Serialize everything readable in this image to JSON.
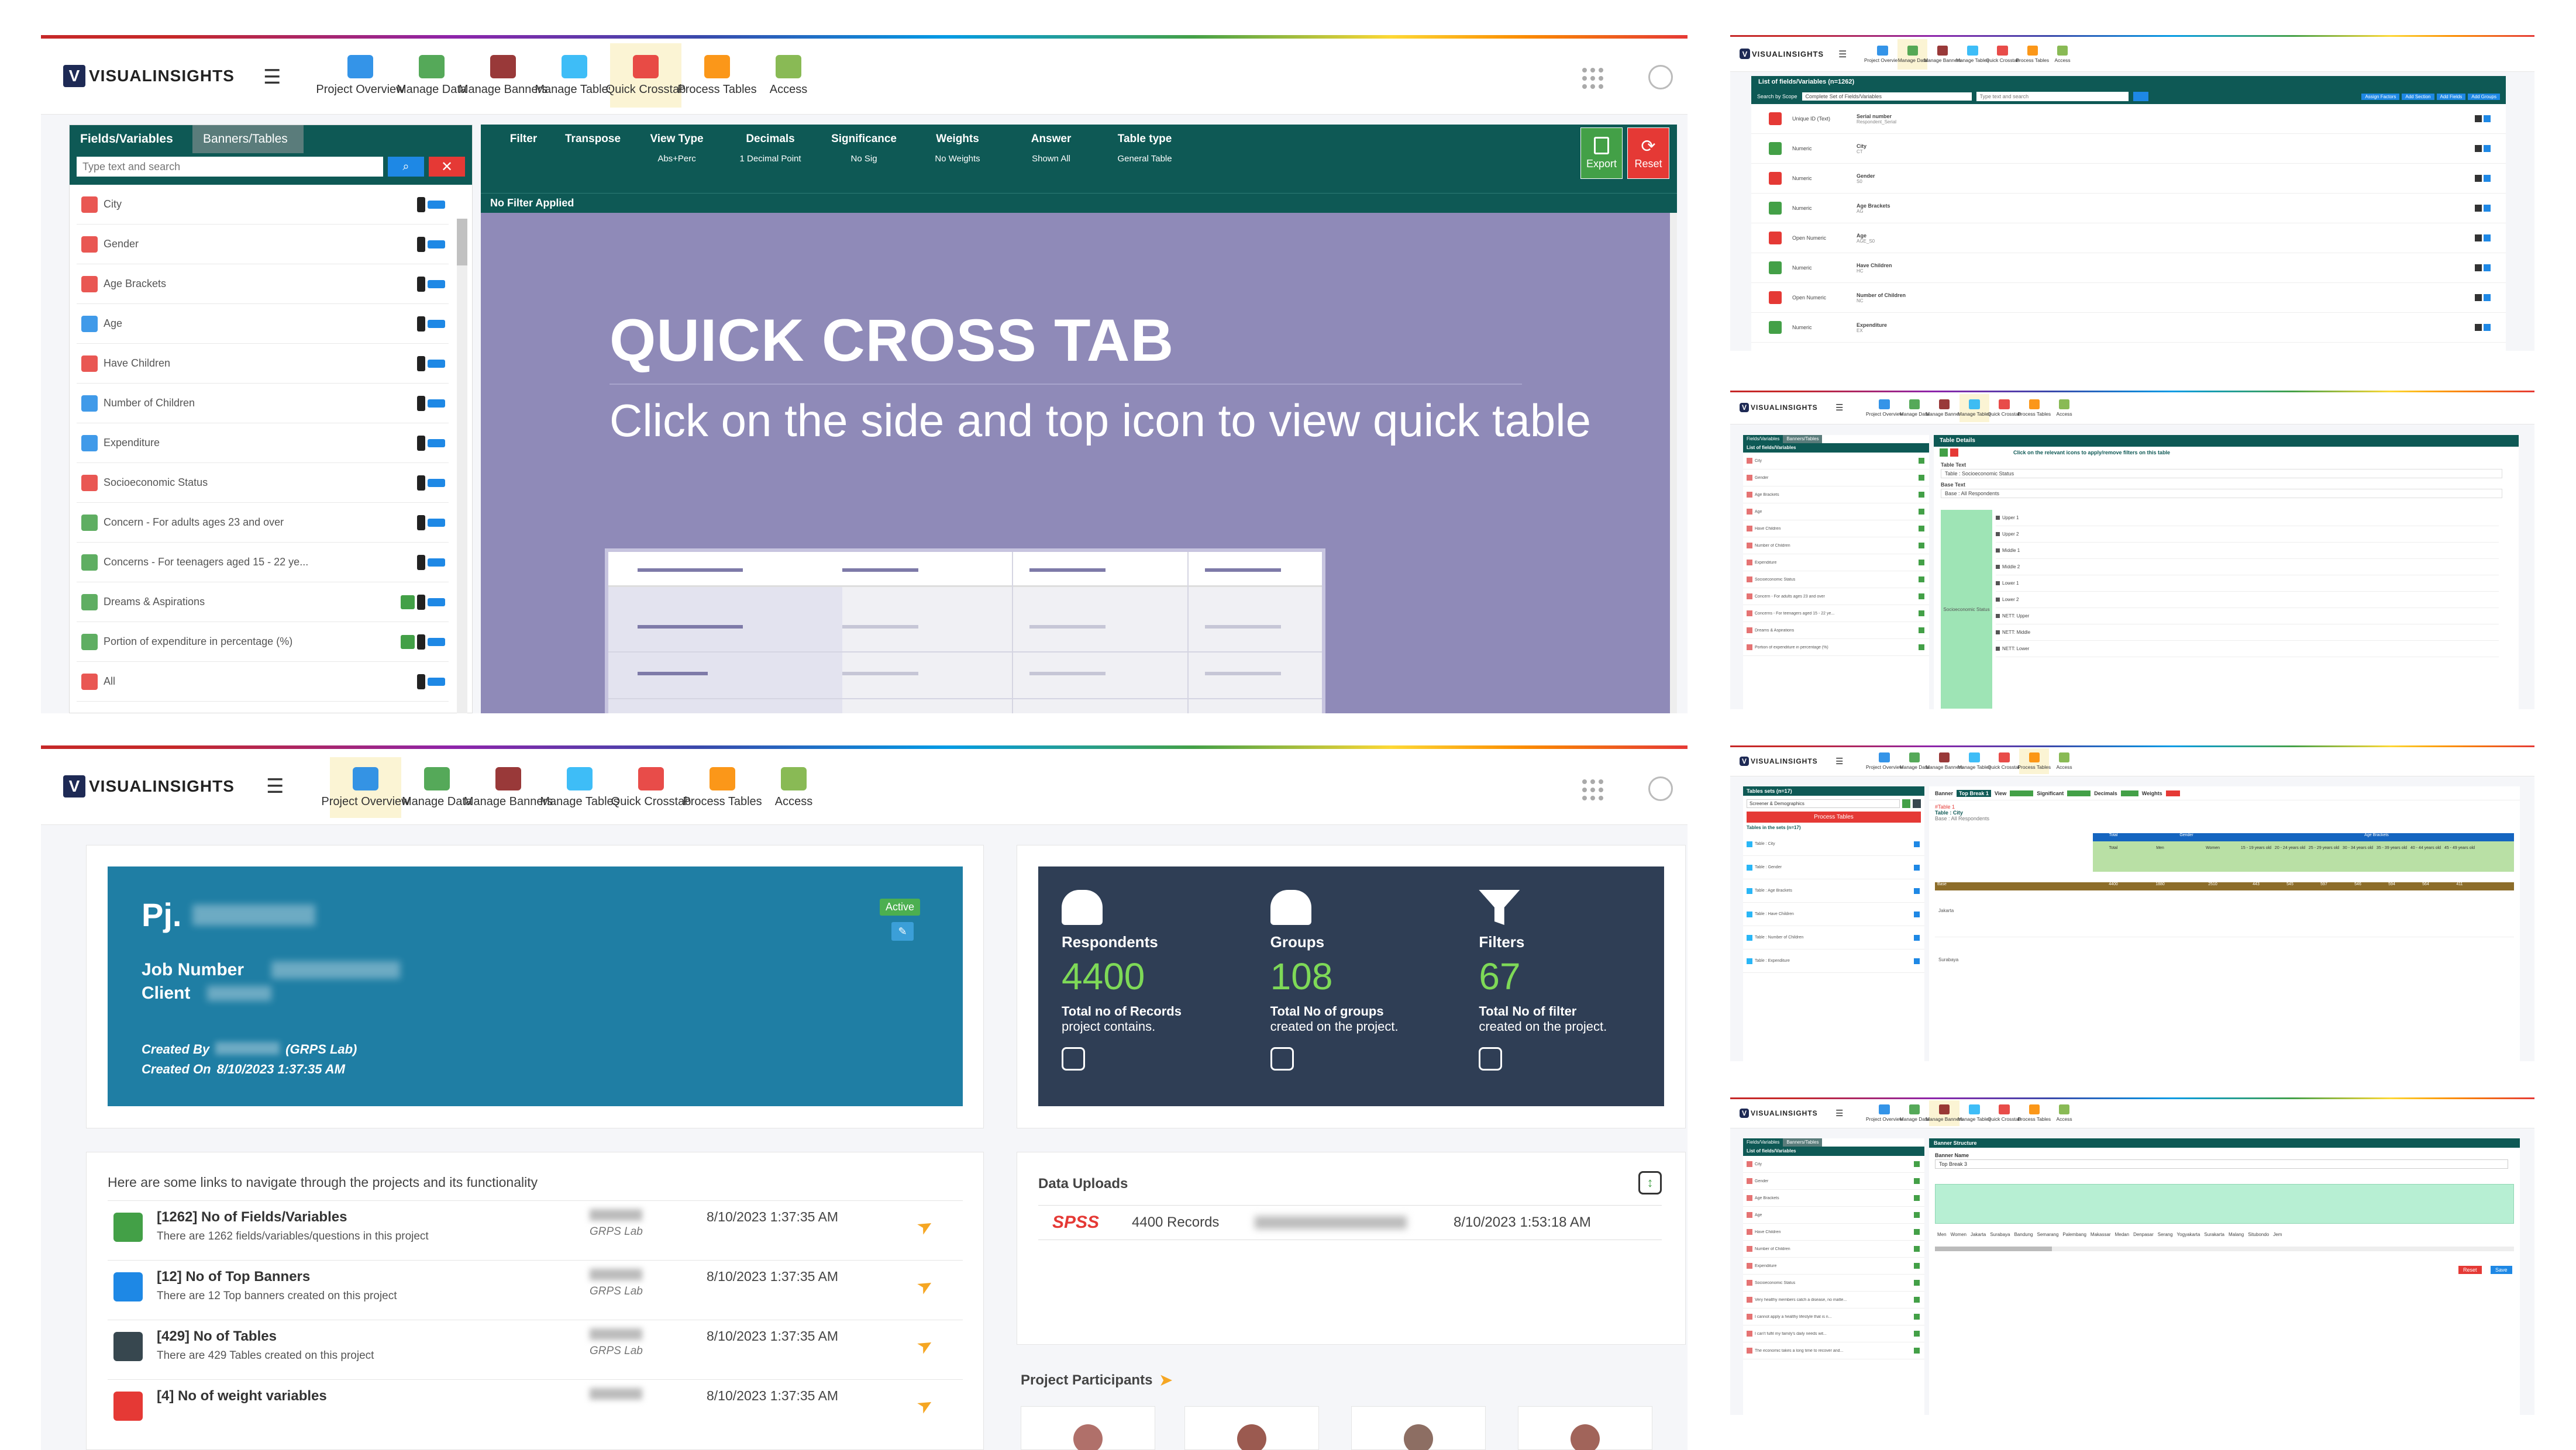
{
  "nav": {
    "logo_text": "VISUALINSIGHTS",
    "logo_letter": "V",
    "items": [
      {
        "label": "Project Overview",
        "icon": "chart-search-icon",
        "color": "#1e88e5"
      },
      {
        "label": "Manage Data",
        "icon": "data-icon",
        "color": "#43a047"
      },
      {
        "label": "Manage Banners",
        "icon": "banner-icon",
        "color": "#8e2424"
      },
      {
        "label": "Manage Tables",
        "icon": "table-icon",
        "color": "#29b6f6"
      },
      {
        "label": "Quick Crosstab",
        "icon": "crosstab-icon",
        "color": "#e53935"
      },
      {
        "label": "Process Tables",
        "icon": "magic-wand-icon",
        "color": "#fb8c00"
      },
      {
        "label": "Access",
        "icon": "users-icon",
        "color": "#7cb342"
      }
    ]
  },
  "crosstab": {
    "tabs": [
      "Fields/Variables",
      "Banners/Tables"
    ],
    "search_placeholder": "Type text and search",
    "variables": [
      {
        "name": "City",
        "type": "single"
      },
      {
        "name": "Gender",
        "type": "single"
      },
      {
        "name": "Age Brackets",
        "type": "single"
      },
      {
        "name": "Age",
        "type": "numeric"
      },
      {
        "name": "Have Children",
        "type": "single"
      },
      {
        "name": "Number of Children",
        "type": "numeric"
      },
      {
        "name": "Expenditure",
        "type": "numeric"
      },
      {
        "name": "Socioeconomic Status",
        "type": "single"
      },
      {
        "name": "Concern - For adults ages 23 and over",
        "type": "multi"
      },
      {
        "name": "Concerns - For teenagers aged 15 - 22 ye...",
        "type": "multi"
      },
      {
        "name": "Dreams & Aspirations",
        "type": "multi"
      },
      {
        "name": "Portion of expenditure in percentage (%)",
        "type": "multi"
      },
      {
        "name": "All",
        "type": "single"
      }
    ],
    "toolbar": [
      {
        "label": "Filter",
        "sub": ""
      },
      {
        "label": "Transpose",
        "sub": ""
      },
      {
        "label": "View Type",
        "sub": "Abs+Perc"
      },
      {
        "label": "Decimals",
        "sub": "1 Decimal Point"
      },
      {
        "label": "Significance",
        "sub": "No Sig"
      },
      {
        "label": "Weights",
        "sub": "No Weights"
      },
      {
        "label": "Answer",
        "sub": "Shown All"
      },
      {
        "label": "Table type",
        "sub": "General Table"
      }
    ],
    "export_label": "Export",
    "reset_label": "Reset",
    "filter_status": "No Filter Applied",
    "hero_title": "QUICK CROSS TAB",
    "hero_sub": "Click on the side and top icon to view quick table"
  },
  "overview": {
    "project_initial": "Pj.",
    "status": "Active",
    "job_number_label": "Job Number",
    "client_label": "Client",
    "created_by_label": "Created By",
    "created_by_org": "(GRPS Lab)",
    "created_on_label": "Created On",
    "created_on_value": "8/10/2023 1:37:35 AM",
    "stats": [
      {
        "title": "Respondents",
        "value": "4400",
        "desc1": "Total no of Records",
        "desc2": "project contains.",
        "icon": "people-icon"
      },
      {
        "title": "Groups",
        "value": "108",
        "desc1": "Total No of groups",
        "desc2": "created on the project.",
        "icon": "group-icon"
      },
      {
        "title": "Filters",
        "value": "67",
        "desc1": "Total No of filter",
        "desc2": "created on the project.",
        "icon": "funnel-icon"
      }
    ],
    "links_header": "Here are some links to navigate through the projects and its functionality",
    "links": [
      {
        "title": "[1262] No of Fields/Variables",
        "desc": "There are 1262 fields/variables/questions in this project",
        "org": "GRPS Lab",
        "date": "8/10/2023 1:37:35 AM",
        "icon": "map-icon",
        "color": "#43a047"
      },
      {
        "title": "[12] No of Top Banners",
        "desc": "There are 12 Top banners created on this project",
        "org": "GRPS Lab",
        "date": "8/10/2023 1:37:35 AM",
        "icon": "css-icon",
        "color": "#1e88e5"
      },
      {
        "title": "[429] No of Tables",
        "desc": "There are 429 Tables created on this project",
        "org": "GRPS Lab",
        "date": "8/10/2023 1:37:35 AM",
        "icon": "table-list-icon",
        "color": "#37474f"
      },
      {
        "title": "[4] No of weight variables",
        "desc": "",
        "org": "",
        "date": "8/10/2023 1:37:35 AM",
        "icon": "weight-icon",
        "color": "#e53935"
      }
    ],
    "uploads_header": "Data Uploads",
    "upload": {
      "type": "SPSS",
      "records": "4400 Records",
      "date": "8/10/2023 1:53:18 AM"
    },
    "participants_header": "Project Participants"
  },
  "thumbs": {
    "data": {
      "header": "List of fields/Variables (n=1262)",
      "search_label": "Search by Scope",
      "search_scope": "Complete Set of Fields/Variables",
      "search_placeholder": "Type text and search",
      "buttons": [
        "Assign Factors",
        "Add Section",
        "Add Fields",
        "Add Groups"
      ],
      "rows": [
        {
          "type": "Unique ID (Text)",
          "name": "Serial number",
          "code": "Respondent_Serial"
        },
        {
          "type": "Numeric",
          "name": "City",
          "code": "CT"
        },
        {
          "type": "Numeric",
          "name": "Gender",
          "code": "S0"
        },
        {
          "type": "Numeric",
          "name": "Age Brackets",
          "code": "AG"
        },
        {
          "type": "Open Numeric",
          "name": "Age",
          "code": "AGE_S0"
        },
        {
          "type": "Numeric",
          "name": "Have Children",
          "code": "HC"
        },
        {
          "type": "Open Numeric",
          "name": "Number of Children",
          "code": "NC"
        },
        {
          "type": "Numeric",
          "name": "Expenditure",
          "code": "EX"
        }
      ]
    },
    "tables": {
      "header": "Table Details",
      "hint": "Click on the relevant icons to apply/remove filters on this table",
      "table_text_label": "Table Text",
      "table_text": "Table : Socioeconomic Status",
      "base_text_label": "Base Text",
      "base_text": "Base : All Respondents",
      "side_label": "Socioeconomic Status",
      "codes": [
        "Upper 1",
        "Upper 2",
        "Middle 1",
        "Middle 2",
        "Lower 1",
        "Lower 2",
        "NETT: Upper",
        "NETT: Middle",
        "NETT: Lower"
      ],
      "list_header": "List of fields/Variables",
      "list": [
        "City",
        "Gender",
        "Age Brackets",
        "Age",
        "Have Children",
        "Number of Children",
        "Expenditure",
        "Socioeconomic Status",
        "Concern - For adults ages 23 and over",
        "Concerns - For teenagers aged 15 - 22 ye...",
        "Dreams & Aspirations",
        "Portion of expenditure in percentage (%)"
      ]
    },
    "process": {
      "sets_header": "Tables sets (n=17)",
      "set_select": "Screener & Demographics",
      "process_btn": "Process Tables",
      "tables_header": "Tables in the sets (n=17)",
      "tables": [
        "Table : City",
        "Table : Gender",
        "Table : Age Brackets",
        "Table : Have Children",
        "Table : Number of Children",
        "Table : Expenditure"
      ],
      "banner_label": "Banner",
      "banner_value": "Top Break 1",
      "view_label": "View",
      "sig_label": "Significant",
      "dec_label": "Decimals",
      "weights_label": "Weights",
      "table_num": "#Table 1",
      "table_title": "Table : City",
      "base": "Base : All Respondents",
      "groups": [
        "Total",
        "Gender",
        "Age Brackets"
      ],
      "cols": [
        "Total",
        "Men",
        "Women",
        "15 - 19 years old",
        "20 - 24 years old",
        "25 - 29 years old",
        "30 - 34 years old",
        "35 - 39 years old",
        "40 - 44 years old",
        "45 - 49 years old"
      ],
      "base_row": [
        "4400",
        "1880",
        "2510",
        "443",
        "545",
        "597",
        "546",
        "594",
        "564",
        "411"
      ],
      "jakarta": "Jakarta",
      "surabaya": "Surabaya"
    },
    "banners": {
      "header": "Banner Structure",
      "name_label": "Banner Name",
      "name_value": "Top Break 3",
      "cols": [
        "Men",
        "Women",
        "Jakarta",
        "Surabaya",
        "Bandung",
        "Semarang",
        "Palembang",
        "Makassar",
        "Medan",
        "Denpasar",
        "Serang",
        "Yogyakarta",
        "Surakarta",
        "Malang",
        "Situbondo",
        "Jem"
      ],
      "reset": "Reset",
      "save": "Save",
      "list": [
        "City",
        "Gender",
        "Age Brackets",
        "Age",
        "Have Children",
        "Number of Children",
        "Expenditure",
        "Socioeconomic Status",
        "Very healthy members catch a disease, no matte...",
        "I cannot apply a healthy lifestyle that is n...",
        "I can't fulfil my family's daily needs wit...",
        "The economic takes a long time to recover and..."
      ]
    }
  },
  "colors": {
    "teal": "#0e5955",
    "green_stat": "#7ed957",
    "blue_card": "#1f7ea4",
    "dark_card": "#2f3e55",
    "hero": "#8f8ab8"
  }
}
